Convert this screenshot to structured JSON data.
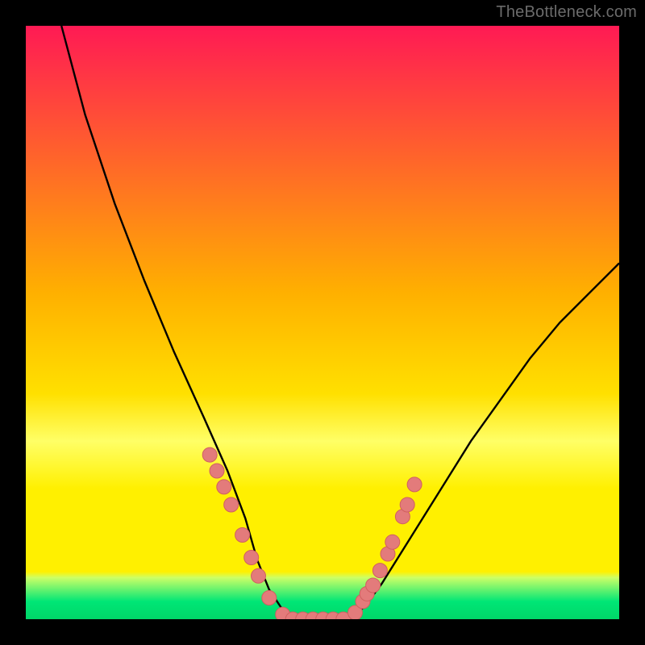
{
  "watermark": {
    "text": "TheBottleneck.com"
  },
  "colors": {
    "background": "#000000",
    "watermark": "#6b6b6b",
    "gradient_top": "#ff1a54",
    "gradient_mid": "#ffd400",
    "gradient_low": "#ffff66",
    "gradient_band": "#ccff66",
    "gradient_bottom": "#00e676",
    "curve": "#000000",
    "marker_fill": "#e37b7b",
    "marker_stroke": "#d06060"
  },
  "chart_data": {
    "type": "line",
    "title": "",
    "xlabel": "",
    "ylabel": "",
    "xlim": [
      0,
      100
    ],
    "ylim": [
      0,
      100
    ],
    "grid": false,
    "legend": false,
    "series": [
      {
        "name": "bottleneck-curve",
        "x": [
          6,
          10,
          15,
          20,
          25,
          30,
          34,
          37,
          39,
          41,
          43,
          45,
          48,
          52,
          55,
          57,
          60,
          65,
          70,
          75,
          80,
          85,
          90,
          95,
          100
        ],
        "y": [
          100,
          85,
          70,
          57,
          45,
          34,
          25,
          17,
          10,
          5,
          2,
          0.5,
          0,
          0,
          0.5,
          2,
          6,
          14,
          22,
          30,
          37,
          44,
          50,
          55,
          60
        ]
      }
    ],
    "markers": [
      {
        "name": "left-cluster",
        "x": [
          31,
          32.2,
          33.4,
          34.6,
          36.5,
          38,
          39.2,
          41,
          43.3
        ],
        "y": [
          27.7,
          25.0,
          22.3,
          19.3,
          14.2,
          10.4,
          7.3,
          3.6,
          0.8
        ]
      },
      {
        "name": "floor-cluster",
        "x": [
          45,
          46.7,
          48.4,
          50.1,
          51.8,
          53.5
        ],
        "y": [
          0,
          0,
          0,
          0,
          0,
          0
        ]
      },
      {
        "name": "right-cluster",
        "x": [
          55.5,
          56.8,
          57.5,
          58.5,
          59.7,
          61.0,
          61.8,
          63.5,
          64.3,
          65.5
        ],
        "y": [
          1.1,
          3.0,
          4.3,
          5.7,
          8.2,
          11.0,
          13.0,
          17.3,
          19.3,
          22.7
        ]
      }
    ],
    "gradient_bands": [
      {
        "name": "pale-yellow-band",
        "y0": 70,
        "y1": 78
      },
      {
        "name": "yellow-green-band",
        "y0": 92.8,
        "y1": 96.5
      }
    ]
  }
}
